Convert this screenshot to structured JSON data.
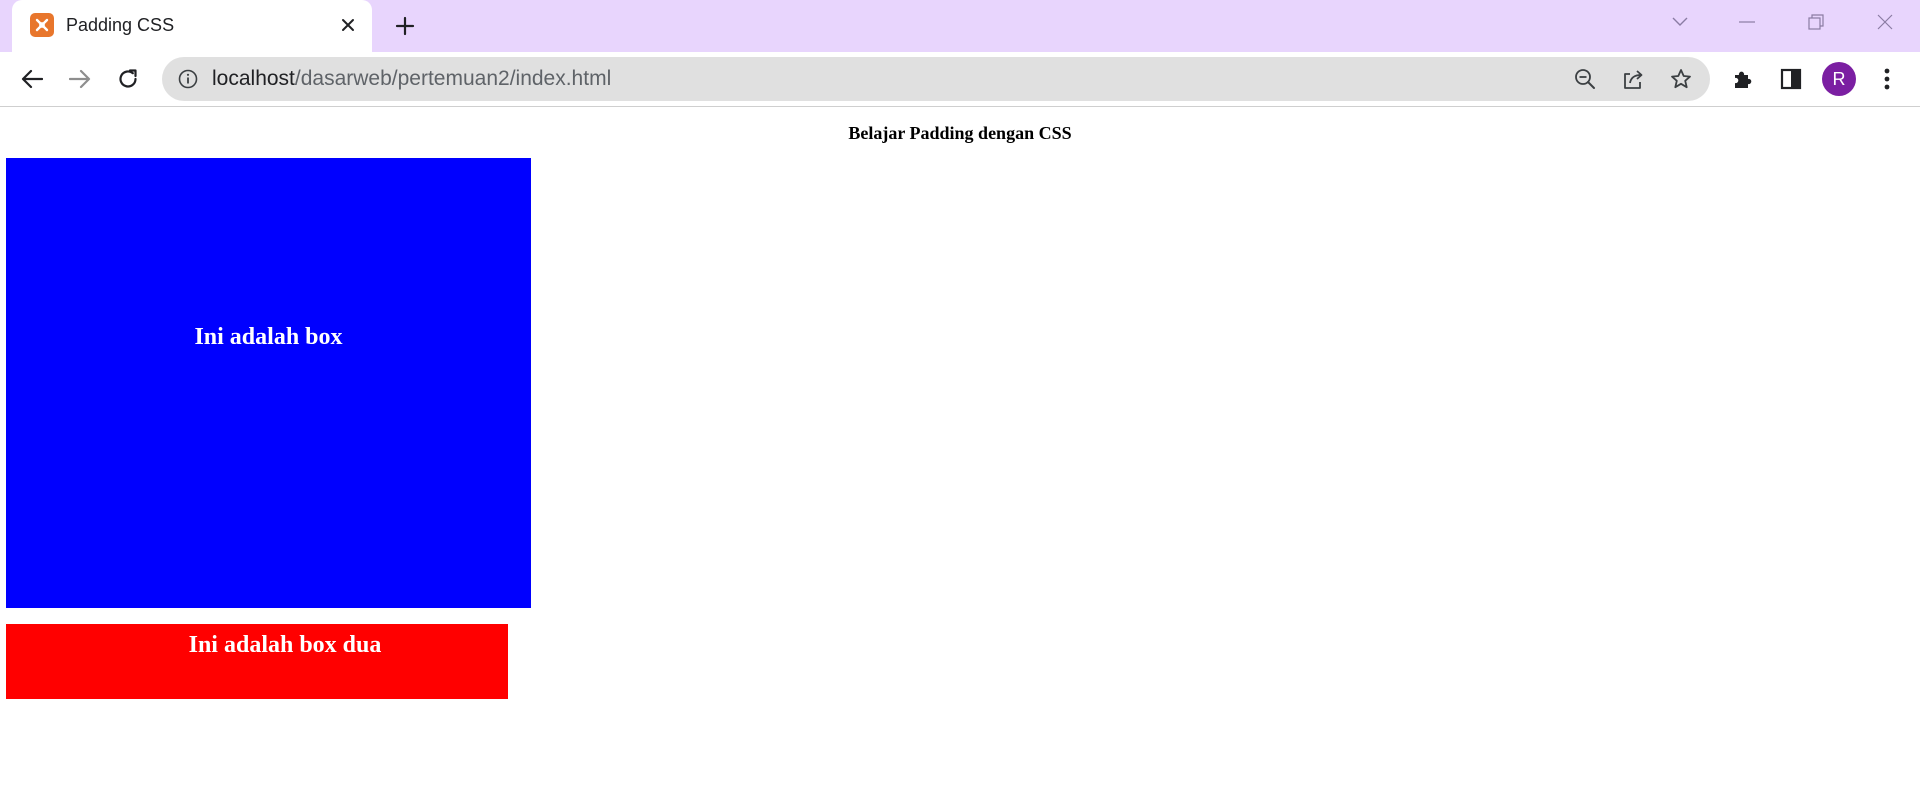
{
  "browser": {
    "tab": {
      "title": "Padding CSS",
      "favicon_color": "#e8762c"
    },
    "tabstrip_color": "#e8d5fd",
    "address_bar": {
      "url_host": "localhost",
      "url_path": "/dasarweb/pertemuan2/index.html"
    },
    "profile": {
      "initial": "R",
      "color": "#7b1fa2"
    }
  },
  "page": {
    "heading": "Belajar Padding dengan CSS",
    "box_one": {
      "text": "Ini adalah box",
      "color": "#0000ff"
    },
    "box_two": {
      "text": "Ini adalah box dua",
      "color": "#ff0000"
    }
  }
}
